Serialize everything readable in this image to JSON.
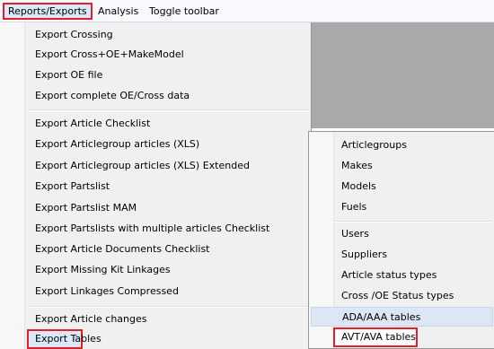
{
  "menubar": {
    "items": [
      {
        "label": "Reports/Exports"
      },
      {
        "label": "Analysis"
      },
      {
        "label": "Toggle toolbar"
      }
    ]
  },
  "reports_menu": {
    "items": [
      {
        "label": "Export Crossing"
      },
      {
        "label": "Export Cross+OE+MakeModel"
      },
      {
        "label": "Export OE file"
      },
      {
        "label": "Export complete OE/Cross data"
      },
      {
        "label": "Export Article Checklist"
      },
      {
        "label": "Export Articlegroup articles (XLS)"
      },
      {
        "label": "Export Articlegroup articles (XLS) Extended"
      },
      {
        "label": "Export Partslist"
      },
      {
        "label": "Export Partslist MAM"
      },
      {
        "label": "Export Partslists with multiple articles Checklist"
      },
      {
        "label": "Export Article Documents Checklist"
      },
      {
        "label": "Export Missing Kit Linkages"
      },
      {
        "label": "Export Linkages Compressed"
      },
      {
        "label": "Export Article changes"
      },
      {
        "label": "Export Tables"
      }
    ]
  },
  "tables_submenu": {
    "items": [
      {
        "label": "Articlegroups"
      },
      {
        "label": "Makes"
      },
      {
        "label": "Models"
      },
      {
        "label": "Fuels"
      },
      {
        "label": "Users"
      },
      {
        "label": "Suppliers"
      },
      {
        "label": "Article status types"
      },
      {
        "label": "Cross /OE Status types"
      },
      {
        "label": "ADA/AAA tables"
      },
      {
        "label": "AVT/AVA tables"
      }
    ]
  },
  "colors": {
    "highlight_border": "#e0212a",
    "menu_background": "#f0f0f0",
    "hover_background": "#dce6f4",
    "gray_area": "#a9a9a9"
  }
}
